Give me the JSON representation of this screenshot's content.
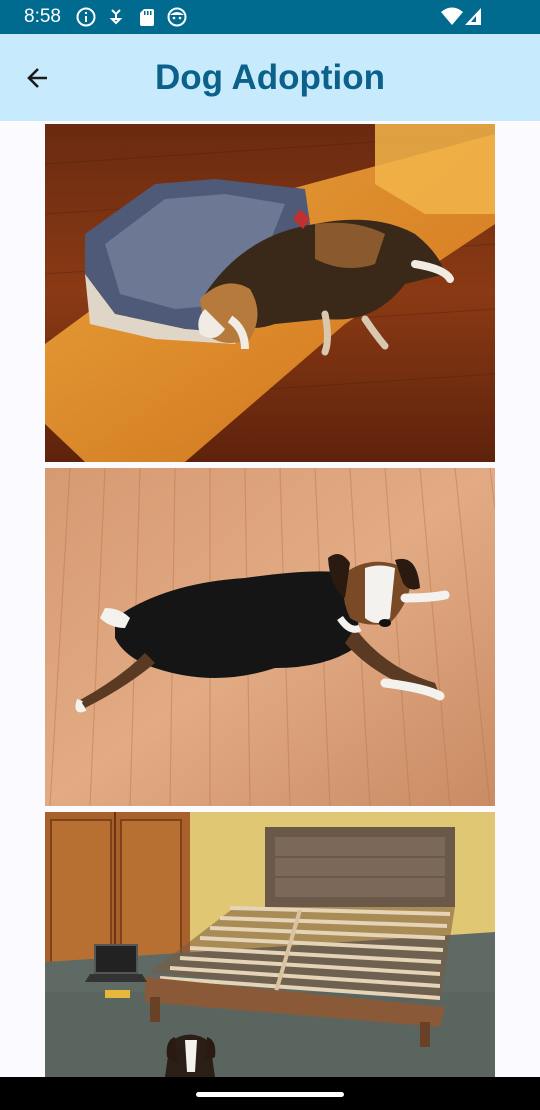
{
  "status_bar": {
    "time": "8:58",
    "left_icons": [
      "info-icon",
      "data-saver-icon",
      "sd-card-icon",
      "notification-face-icon"
    ],
    "right_icons": [
      "wifi-icon",
      "signal-icon"
    ],
    "background": "#016a8f"
  },
  "app_bar": {
    "title": "Dog Adoption",
    "back_icon": "arrow-back-icon",
    "background": "#c8eafd",
    "title_color": "#0b6189"
  },
  "photos": [
    {
      "subject": "beagle sleeping on hardwood floor next to a quilt"
    },
    {
      "subject": "beagle lying on light hardwood floor looking up"
    },
    {
      "subject": "beagle sitting in front of a wooden bed frame"
    }
  ]
}
